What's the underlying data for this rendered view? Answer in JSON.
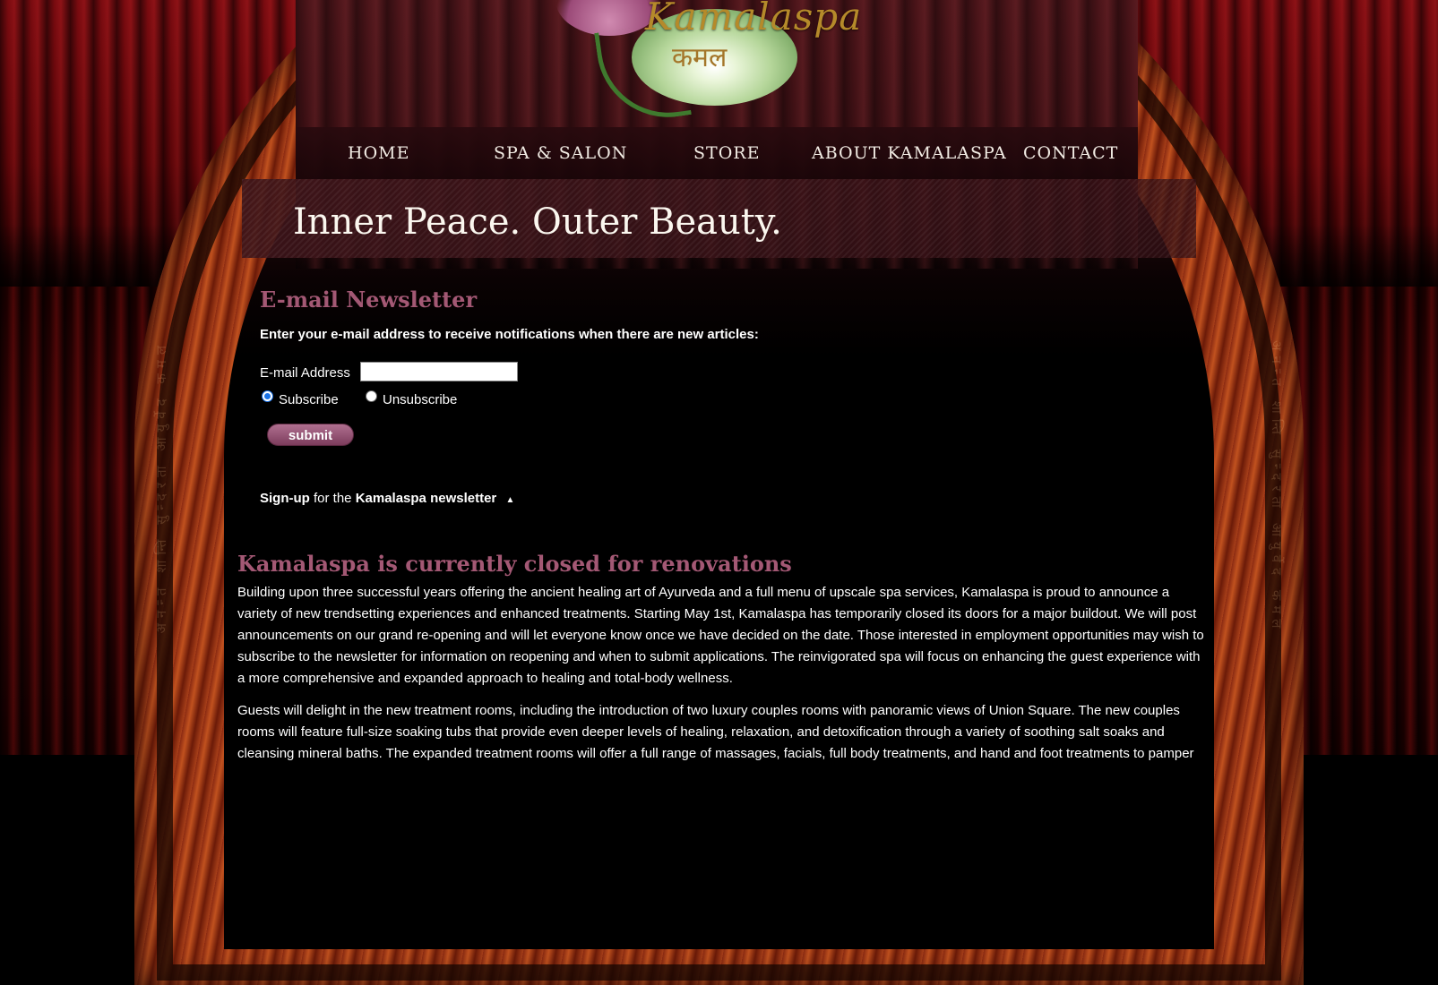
{
  "logo": {
    "wordmark": "Kamalaspa",
    "devanagari": "कमल"
  },
  "nav": {
    "items": [
      {
        "label": "HOME"
      },
      {
        "label": "SPA & SALON"
      },
      {
        "label": "STORE"
      },
      {
        "label": "ABOUT KAMALASPA"
      },
      {
        "label": "CONTACT"
      }
    ]
  },
  "tagline": "Inner Peace. Outer Beauty.",
  "newsletter": {
    "heading": "E-mail Newsletter",
    "instructions": "Enter your e-mail address to receive notifications when there are new articles:",
    "email_label": "E-mail Address",
    "email_value": "",
    "subscribe_label": "Subscribe",
    "unsubscribe_label": "Unsubscribe",
    "selected": "Subscribe",
    "submit_label": "submit",
    "signup_part1": "Sign-up",
    "signup_part2": " for the ",
    "signup_part3": "Kamalaspa newsletter",
    "signup_arrow": "▲"
  },
  "article": {
    "heading": "Kamalaspa is currently closed for renovations",
    "paragraph1": "Building upon three successful years offering the ancient healing art of Ayurveda and a full menu of upscale spa services, Kamalaspa is proud to announce a variety of new trendsetting experiences and enhanced treatments. Starting May 1st, Kamalaspa has temporarily closed its doors for a major buildout. We will post announcements on our grand re-opening and will let everyone know once we have decided on the date. Those interested in employment opportunities may wish to subscribe to the newsletter for information on reopening and when to submit applications. The reinvigorated spa will focus on enhancing the guest experience with a more comprehensive and expanded approach to healing and total-body wellness.",
    "paragraph2": "Guests will delight in the new treatment rooms, including the introduction of two luxury couples rooms with panoramic views of Union Square. The new couples rooms will feature full-size soaking tubs that provide even deeper levels of healing, relaxation, and detoxification through a variety of soothing salt soaks and cleansing mineral baths. The expanded treatment rooms will offer a full range of massages, facials, full body treatments, and hand and foot treatments to pamper"
  },
  "decor": {
    "arch_text_left": "अनन्त शान्ति सुन्दरता आयुर्वेद कमल",
    "arch_text_right": "अनन्त शान्ति सुन्दरता आयुर्वेद कमल"
  },
  "colors": {
    "heading_accent": "#a35874",
    "curtain_red": "#7a0b10",
    "arch_wood": "#c1521f",
    "button": "#8e4a6c"
  }
}
